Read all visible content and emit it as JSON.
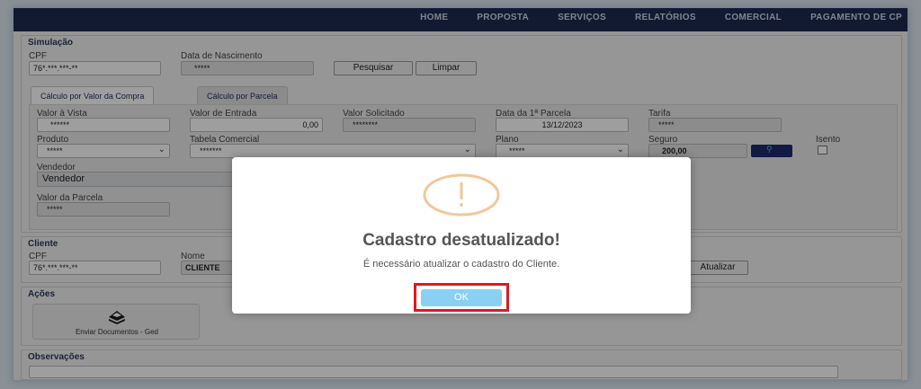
{
  "nav": {
    "items": [
      "HOME",
      "PROPOSTA",
      "SERVIÇOS",
      "RELATÓRIOS",
      "COMERCIAL",
      "PAGAMENTO DE CP"
    ]
  },
  "simulacao": {
    "title": "Simulação",
    "cpf_label": "CPF",
    "cpf_value": "76*.***.***-**",
    "nascimento_label": "Data de Nascimento",
    "nascimento_value": "*****",
    "pesquisar_label": "Pesquisar",
    "limpar_label": "Limpar",
    "tabs": [
      {
        "label": "Cálculo por Valor da Compra",
        "active": true
      },
      {
        "label": "Cálculo por Parcela",
        "active": false
      }
    ],
    "fields": {
      "valor_vista_label": "Valor à Vista",
      "valor_vista_value": "******",
      "valor_entrada_label": "Valor de Entrada",
      "valor_entrada_value": "0,00",
      "valor_solicitado_label": "Valor Solicitado",
      "valor_solicitado_value": "********",
      "data_parcela_label": "Data da 1ª Parcela",
      "data_parcela_value": "13/12/2023",
      "tarifa_label": "Tarifa",
      "tarifa_value": "*****",
      "produto_label": "Produto",
      "produto_value": "*****",
      "tabela_label": "Tabela Comercial",
      "tabela_value": "*******",
      "plano_label": "Plano",
      "plano_value": "*****",
      "seguro_label": "Seguro",
      "seguro_value": "200,00",
      "isento_label": "Isento",
      "vendedor_label": "Vendedor",
      "vendedor_value": "Vendedor",
      "valor_parcela_label": "Valor da Parcela",
      "valor_parcela_value": "*****"
    }
  },
  "cliente": {
    "title": "Cliente",
    "cpf_label": "CPF",
    "cpf_value": "76*.***.***-**",
    "nome_label": "Nome",
    "nome_value": "CLIENTE",
    "atualizar_label": "Atualizar"
  },
  "acoes": {
    "title": "Ações",
    "enviar_label": "Enviar Documentos - Ged"
  },
  "observacoes": {
    "title": "Observações"
  },
  "modal": {
    "title": "Cadastro desatualizado!",
    "message": "É necessário atualizar o cadastro do Cliente.",
    "ok_label": "OK",
    "warning_color": "#f2c79a",
    "ok_color": "#8ad0f2",
    "highlight_color": "#e0191e"
  }
}
